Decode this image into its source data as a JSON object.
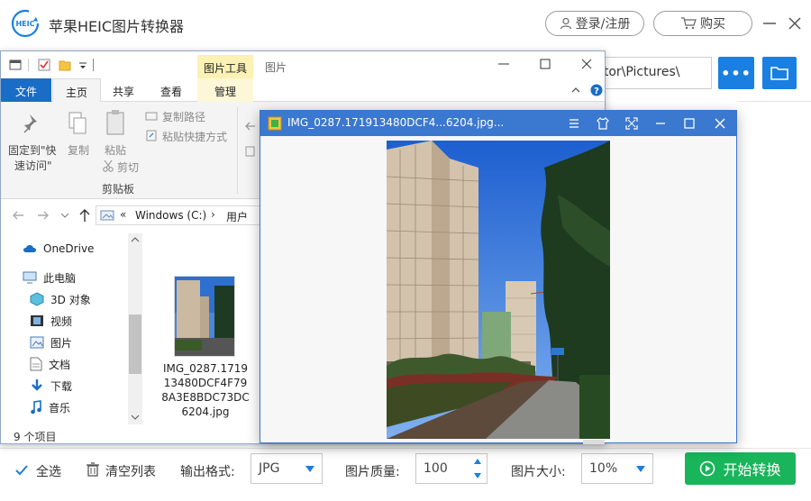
{
  "app": {
    "title": "苹果HEIC图片转换器",
    "logo_text": "HEIC",
    "login_label": "登录/注册",
    "buy_label": "购买",
    "path_value": "trator\\Pictures\\",
    "more_label": "•••"
  },
  "bottom": {
    "select_all": "全选",
    "clear_list": "清空列表",
    "format_label": "输出格式:",
    "format_value": "JPG",
    "quality_label": "图片质量:",
    "quality_value": "100",
    "size_label": "图片大小:",
    "size_value": "10%",
    "start_label": "开始转换"
  },
  "explorer": {
    "picture_tools": "图片工具",
    "window_title": "图片",
    "tabs": [
      "文件",
      "主页",
      "共享",
      "查看",
      "管理"
    ],
    "ribbon": {
      "pin_label_1": "固定到\"快",
      "pin_label_2": "速访问\"",
      "copy": "复制",
      "paste": "粘贴",
      "copy_path": "复制路径",
      "paste_shortcut": "粘贴快捷方式",
      "cut": "剪切",
      "clipboard": "剪贴板"
    },
    "address": {
      "chevrons": "«",
      "crumb_1": "Windows (C:)",
      "crumb_2": "用户"
    },
    "nav_items": [
      {
        "label": "OneDrive",
        "icon": "cloud-icon"
      },
      {
        "label": "此电脑",
        "icon": "computer-icon"
      },
      {
        "label": "3D 对象",
        "icon": "cube-icon"
      },
      {
        "label": "视频",
        "icon": "video-icon"
      },
      {
        "label": "图片",
        "icon": "picture-icon"
      },
      {
        "label": "文档",
        "icon": "document-icon"
      },
      {
        "label": "下载",
        "icon": "download-icon"
      },
      {
        "label": "音乐",
        "icon": "music-icon"
      }
    ],
    "status": "9 个项目",
    "file_name": "IMG_0287.171913480DCF4F798A3E8BDC73DC6204.jpg"
  },
  "viewer": {
    "title": "IMG_0287.171913480DCF4...6204.jpg..."
  },
  "colors": {
    "accent_blue": "#1a7fe0",
    "start_green": "#19b55a",
    "viewer_bar": "#3b78cf",
    "file_tab": "#1a6dc6"
  }
}
